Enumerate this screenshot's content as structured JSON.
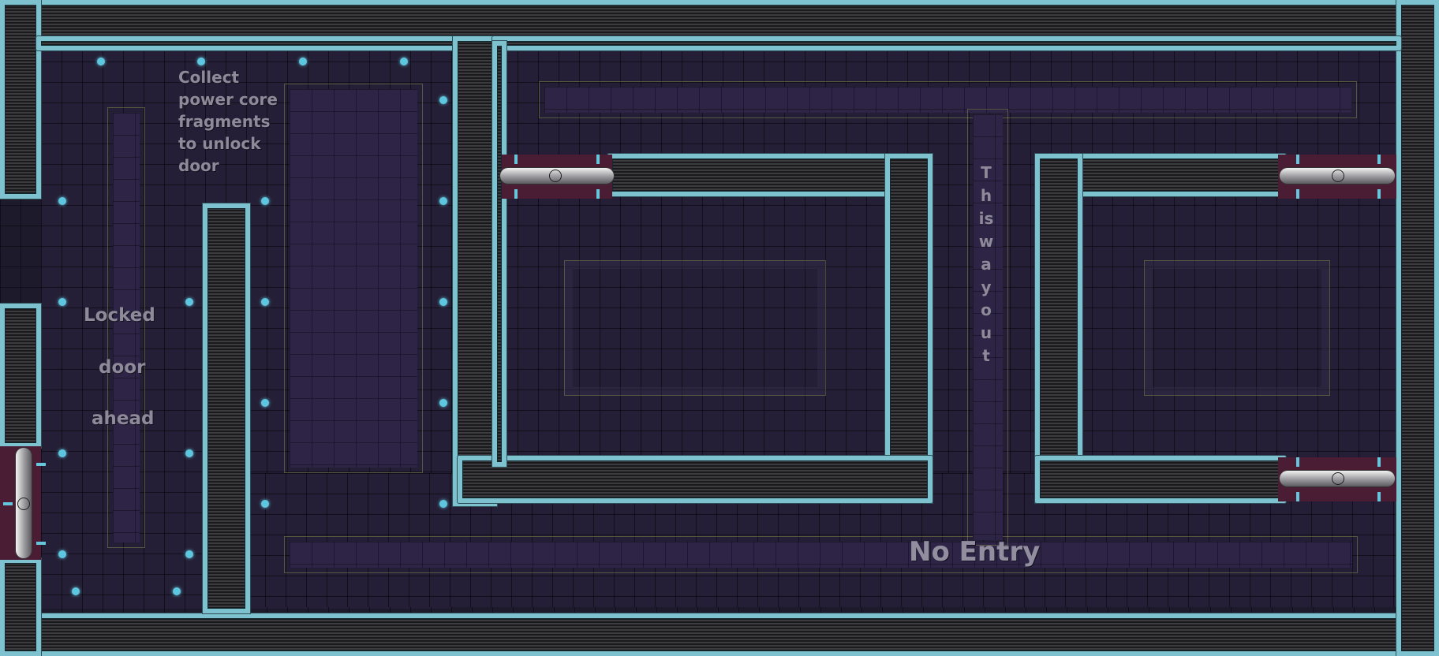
{
  "level": {
    "signs": {
      "collect_hint": "Collect power core fragments to unlock door",
      "locked_line1": "Locked",
      "locked_line2": "door",
      "locked_line3": "ahead",
      "exit_hint": "This way out",
      "no_entry": "No Entry"
    },
    "colors": {
      "wall_trim": "#7fc2cf",
      "wall_fill": "#2a2a2e",
      "floor": "#1d1a2b",
      "pad": "#2e2546",
      "power_dot": "#5ec6df",
      "door_frame": "#4a1d35",
      "text": "#8f8a99"
    },
    "icons": {
      "power_dot": "power-core-dot",
      "door": "sliding-door"
    }
  }
}
